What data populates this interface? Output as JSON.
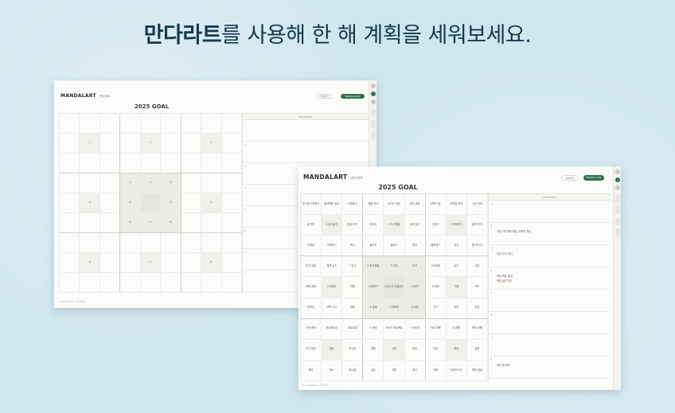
{
  "headline": {
    "bold": "만다라트",
    "rest": "를 사용해 한 해 계획을 세워보세요."
  },
  "colors": {
    "background": "#cfe6ee",
    "brand_green": "#2f6e4f",
    "headline": "#163a4a"
  },
  "app": {
    "logo": "MANDALART",
    "logo_sub": "만다라트",
    "btn_light": "저장하기",
    "btn_green": "MANDALART",
    "goal_title": "2025 GOAL",
    "keywords_header": "KEYWORDS",
    "footer": "© mandalart · 만다라트"
  },
  "back_window": {
    "cells": [
      "",
      "",
      "",
      "",
      "",
      "",
      "",
      "",
      "",
      "",
      "1",
      "",
      "",
      "2",
      "",
      "",
      "3",
      "",
      "",
      "",
      "",
      "",
      "",
      "",
      "",
      "",
      "",
      "",
      "",
      "",
      "1",
      "2",
      "3",
      "",
      "",
      "",
      "",
      "4",
      "",
      "4",
      "",
      "5",
      "",
      "5",
      "",
      "",
      "",
      "",
      "6",
      "7",
      "8",
      "",
      "",
      "",
      "",
      "",
      "",
      "",
      "",
      "",
      "",
      "",
      "",
      "",
      "6",
      "",
      "",
      "7",
      "",
      "",
      "8",
      "",
      "",
      "",
      "",
      "",
      "",
      "",
      "",
      "",
      ""
    ],
    "keyword_rows": [
      "1",
      "2",
      "3",
      "4",
      "5",
      "6",
      "7",
      "8"
    ]
  },
  "front_window": {
    "cells": [
      "월 1회 기부하기",
      "봉사활동 참여",
      "이웃돕기",
      "매일 독서",
      "인스타 공유",
      "매주 공부",
      "새벽 기상",
      "자격증 공부",
      "시간 관리",
      "꿈 적기",
      "1 감사일기",
      "명상 하기",
      "외국어",
      "2 자기계발",
      "강의 듣기",
      "건강식",
      "3 운동하기",
      "일찍 자기",
      "가계부",
      "저축하기",
      "독서",
      "글쓰기",
      "블로그",
      "영어",
      "필라테스",
      "걷기",
      "물 마시기",
      "투자 공부",
      "경제 뉴스",
      "1 감사",
      "2 자기계발",
      "3 건강",
      "요가",
      "스트레칭",
      "금주",
      "식단",
      "여행 계획",
      "4 재테크",
      "여행",
      "4 재테크",
      "2025년 갓생살기",
      "5 취미",
      "5 취미",
      "그림",
      "악기",
      "부모님",
      "가족 식사",
      "전화",
      "6 관계",
      "7 커리어",
      "8 여행",
      "친구",
      "연락",
      "모임",
      "이직 준비",
      "포트폴리오",
      "네트워킹",
      "6 관계",
      "사이드 프로젝트",
      "7 커리어",
      "국내 여행",
      "8 여행",
      "해외 여행",
      "주간 회의",
      "발표",
      "보고서",
      "캠핑",
      "사진",
      "맛집",
      "여권",
      "예산",
      "일정",
      "정리",
      "청소",
      "미니멀",
      "공유",
      "기록",
      "회고",
      "계획",
      "버킷리스트",
      "목표 점검"
    ],
    "keyword_rows": [
      {
        "num": "1",
        "note": ""
      },
      {
        "num": "2",
        "note": "관련 1월 활동 점검, 만족도 체크"
      },
      {
        "num": "3",
        "note": "건강 수치 개선"
      },
      {
        "num": "4",
        "note": "학습 목표 달성",
        "red": "목표 달성 체크"
      },
      {
        "num": "5",
        "note": ""
      },
      {
        "num": "6",
        "note": ""
      },
      {
        "num": "7",
        "note": ""
      },
      {
        "num": "8",
        "note": "정리 및 회고"
      }
    ]
  }
}
